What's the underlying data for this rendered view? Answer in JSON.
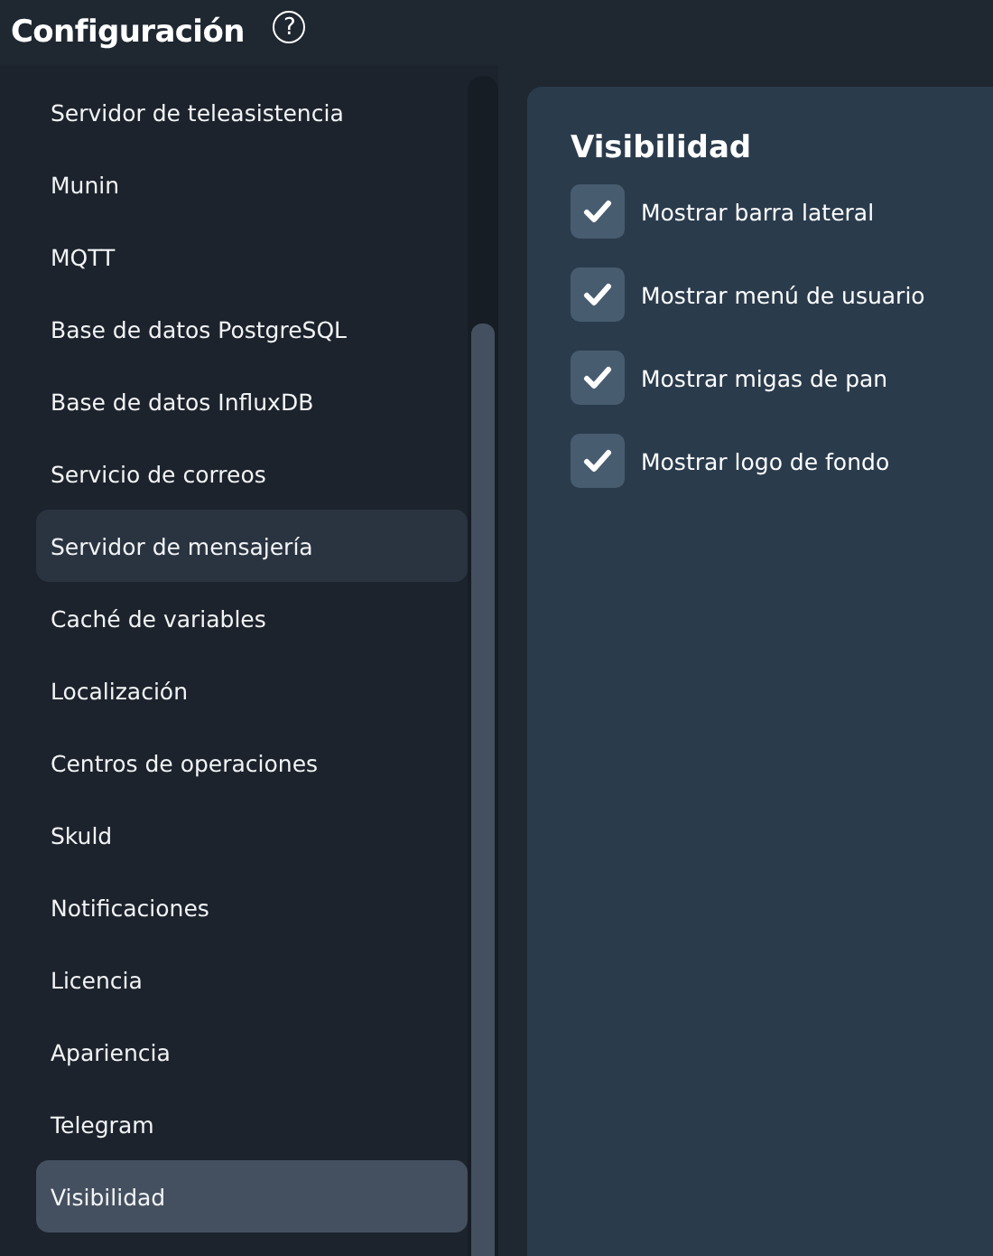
{
  "header": {
    "title": "Configuración",
    "help_icon": "?"
  },
  "sidebar": {
    "items": [
      {
        "label": "Servidor de teleasistencia",
        "selected": false,
        "hovered": false
      },
      {
        "label": "Munin",
        "selected": false,
        "hovered": false
      },
      {
        "label": "MQTT",
        "selected": false,
        "hovered": false
      },
      {
        "label": "Base de datos PostgreSQL",
        "selected": false,
        "hovered": false
      },
      {
        "label": "Base de datos InfluxDB",
        "selected": false,
        "hovered": false
      },
      {
        "label": "Servicio de correos",
        "selected": false,
        "hovered": false
      },
      {
        "label": "Servidor de mensajería",
        "selected": false,
        "hovered": true
      },
      {
        "label": "Caché de variables",
        "selected": false,
        "hovered": false
      },
      {
        "label": "Localización",
        "selected": false,
        "hovered": false
      },
      {
        "label": "Centros de operaciones",
        "selected": false,
        "hovered": false
      },
      {
        "label": "Skuld",
        "selected": false,
        "hovered": false
      },
      {
        "label": "Notificaciones",
        "selected": false,
        "hovered": false
      },
      {
        "label": "Licencia",
        "selected": false,
        "hovered": false
      },
      {
        "label": "Apariencia",
        "selected": false,
        "hovered": false
      },
      {
        "label": "Telegram",
        "selected": false,
        "hovered": false
      },
      {
        "label": "Visibilidad",
        "selected": true,
        "hovered": false
      }
    ]
  },
  "panel": {
    "title": "Visibilidad",
    "options": [
      {
        "label": "Mostrar barra lateral",
        "checked": true
      },
      {
        "label": "Mostrar menú de usuario",
        "checked": true
      },
      {
        "label": "Mostrar migas de pan",
        "checked": true
      },
      {
        "label": "Mostrar logo de fondo",
        "checked": true
      }
    ]
  }
}
